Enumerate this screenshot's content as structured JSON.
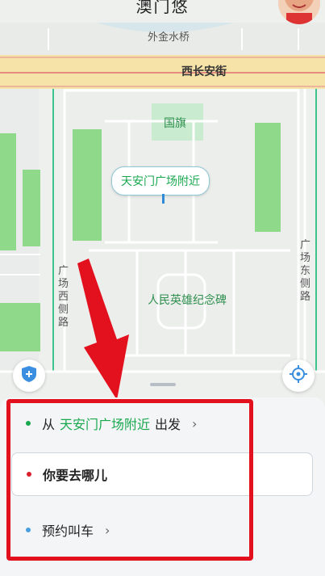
{
  "header": {
    "title": "澳门悠"
  },
  "map": {
    "labels": {
      "waijin_bridge": "外金水桥",
      "changan_street": "西长安街",
      "flag": "国旗",
      "monument": "人民英雄纪念碑",
      "west_road": "广场西侧路",
      "east_road": "广场东侧路"
    },
    "pin_label": "天安门广场附近"
  },
  "panel": {
    "from_prefix": "从",
    "from_location": "天安门广场附近",
    "from_suffix": "出发",
    "destination_label": "你要去哪儿",
    "reserve_label": "预约叫车",
    "chevron": "›"
  },
  "colors": {
    "accent_green": "#1aa84f",
    "dot_red": "#d9212c",
    "dot_blue": "#4a9fe0",
    "annotation_red": "#e3101e"
  }
}
